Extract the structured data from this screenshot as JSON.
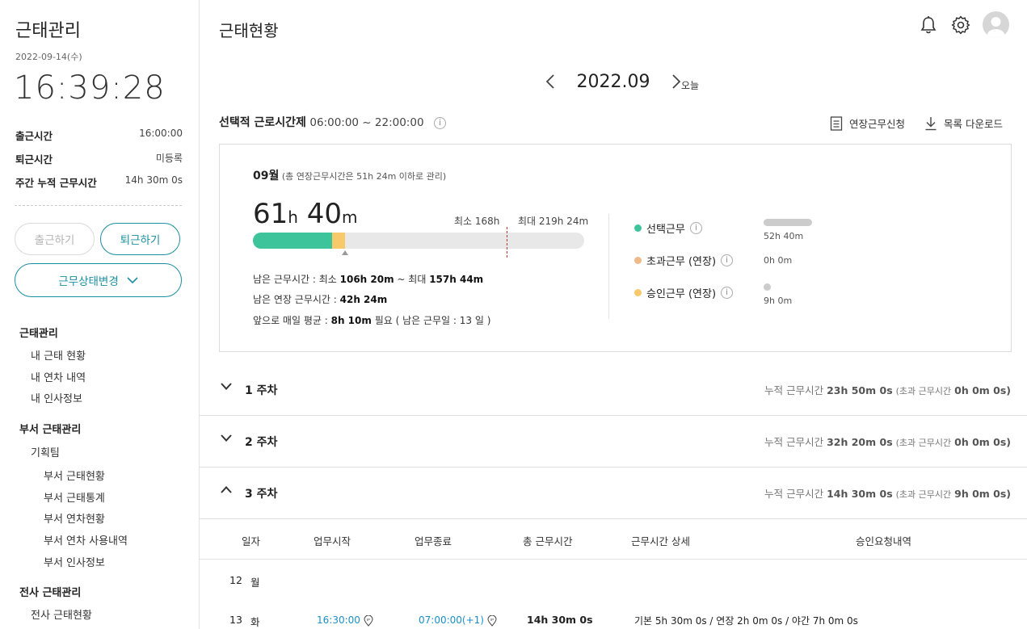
{
  "sidebar": {
    "app_title": "근태관리",
    "date": "2022-09-14(수)",
    "clock": "16:39:28",
    "info": [
      {
        "label": "출근시간",
        "value": "16:00:00"
      },
      {
        "label": "퇴근시간",
        "value": "미등록"
      },
      {
        "label": "주간 누적 근무시간",
        "value": "14h 30m 0s"
      }
    ],
    "btn_clock_in": "출근하기",
    "btn_clock_out": "퇴근하기",
    "btn_status": "근무상태변경",
    "nav": {
      "sec1": "근태관리",
      "sec1_items": [
        "내 근태 현황",
        "내 연차 내역",
        "내 인사정보"
      ],
      "sec2": "부서 근태관리",
      "team": "기획팀",
      "team_items": [
        "부서 근태현황",
        "부서 근태통계",
        "부서 연차현황",
        "부서 연차 사용내역",
        "부서 인사정보"
      ],
      "sec3": "전사 근태관리",
      "sec3_items": [
        "전사 근태현황"
      ]
    }
  },
  "header": {
    "title": "근태현황",
    "icons": [
      "bell-icon",
      "gear-icon",
      "avatar"
    ]
  },
  "month_nav": {
    "label": "2022.09",
    "today": "오늘"
  },
  "policy": {
    "title": "선택적 근로시간제",
    "range": "06:00:00 ~ 22:00:00",
    "info": "i",
    "request_label": "연장근무신청",
    "download_label": "목록 다운로드"
  },
  "summary": {
    "month": "09월",
    "note": "(총 연장근무시간은 51h 24m 이하로 관리)",
    "hours_num": "61",
    "hours_unit": "h",
    "mins_num": "40",
    "mins_unit": "m",
    "min_label": "최소 168h",
    "max_label": "최대 219h 24m",
    "progress": {
      "green_fraction": 0.24,
      "yellow_fraction": 0.04,
      "max_marker_fraction": 0.765
    },
    "lines": [
      {
        "pre": "남은 근무시간 : 최소 ",
        "b1": "106h 20m",
        "mid": " ~ 최대 ",
        "b2": "157h 44m",
        "post": ""
      },
      {
        "pre": "남은 연장 근무시간 : ",
        "b1": "42h 24m",
        "mid": "",
        "b2": "",
        "post": ""
      },
      {
        "pre": "앞으로 매일 평균 : ",
        "b1": "8h 10m",
        "mid": " 필요 ( 남은 근무일 : 13 일 )",
        "b2": "",
        "post": ""
      }
    ],
    "legend": [
      {
        "label": "선택근무",
        "value": "52h 40m",
        "color": "#3ec49a",
        "bar_fraction": 1.0
      },
      {
        "label": "초과근무 (연장)",
        "value": "0h 0m",
        "color": "#f0b98a",
        "bar_fraction": 0
      },
      {
        "label": "승인근무 (연장)",
        "value": "9h 0m",
        "color": "#f8c96a",
        "bar_fraction": 0.17
      }
    ]
  },
  "weeks": [
    {
      "label": "1 주차",
      "sum_label": "누적 근무시간",
      "sum": "23h 50m 0s",
      "extra_label": "(초과 근무시간",
      "extra": "0h 0m 0s)",
      "expanded": false
    },
    {
      "label": "2 주차",
      "sum_label": "누적 근무시간",
      "sum": "32h 20m 0s",
      "extra_label": "(초과 근무시간",
      "extra": "0h 0m 0s)",
      "expanded": false
    },
    {
      "label": "3 주차",
      "sum_label": "누적 근무시간",
      "sum": "14h 30m 0s",
      "extra_label": "(초과 근무시간",
      "extra": "9h 0m 0s)",
      "expanded": true
    }
  ],
  "table": {
    "headers": [
      "일자",
      "업무시작",
      "업무종료",
      "총 근무시간",
      "근무시간 상세",
      "승인요청내역"
    ],
    "rows": [
      {
        "day": "12",
        "weekday": "월",
        "start": "",
        "end": "",
        "total": "",
        "detail": ""
      },
      {
        "day": "13",
        "weekday": "화",
        "start": "16:30:00",
        "end": "07:00:00(+1)",
        "total": "14h 30m 0s",
        "detail": "기본 5h 30m 0s / 연장 2h 0m 0s / 야간 7h 0m 0s"
      }
    ]
  }
}
